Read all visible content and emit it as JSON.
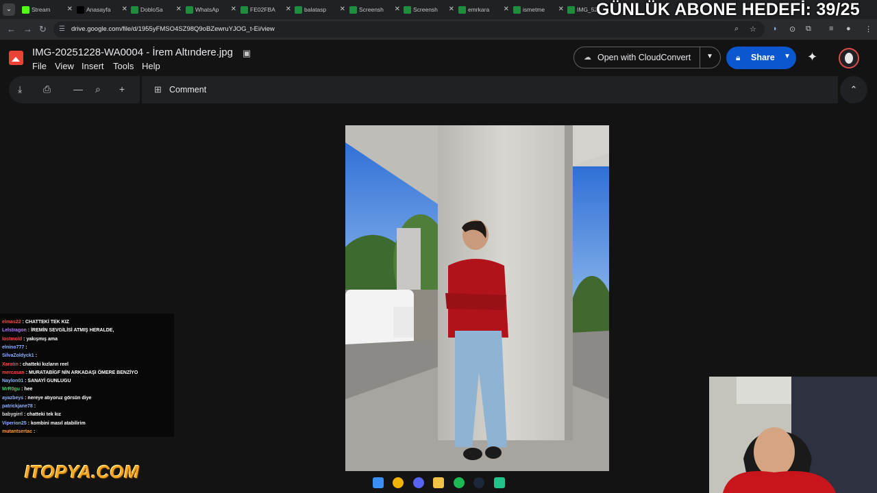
{
  "browser": {
    "tabs": [
      {
        "label": "Stream",
        "icon_color": "#53fc18"
      },
      {
        "label": "Anasayfa",
        "icon_color": "#000000"
      },
      {
        "label": "DobloSa",
        "icon_color": "#1e8e3e"
      },
      {
        "label": "WhatsAp",
        "icon_color": "#1e8e3e"
      },
      {
        "label": "FE02FBA",
        "icon_color": "#1e8e3e"
      },
      {
        "label": "balatasp",
        "icon_color": "#1e8e3e"
      },
      {
        "label": "Screensh",
        "icon_color": "#1e8e3e"
      },
      {
        "label": "Screensh",
        "icon_color": "#1e8e3e"
      },
      {
        "label": "emrkara",
        "icon_color": "#1e8e3e"
      },
      {
        "label": "ismetme",
        "icon_color": "#1e8e3e"
      },
      {
        "label": "IMG_52",
        "icon_color": "#1e8e3e"
      }
    ],
    "url": "drive.google.com/file/d/1955yFMSO4SZ98Q9oBZewruYJOG_t-Ei/view"
  },
  "overlay": {
    "goal_text": "GÜNLÜK ABONE HEDEFİ: 39/25",
    "logo_text": "ITOPYA.COM"
  },
  "drive": {
    "file_name": "IMG-20251228-WA0004 - İrem Altındere.jpg",
    "menus": [
      "File",
      "View",
      "Insert",
      "Tools",
      "Help"
    ],
    "open_with_label": "Open with CloudConvert",
    "share_label": "Share",
    "comment_label": "Comment",
    "accent": "#0b57d0"
  },
  "chat": [
    {
      "user": "elmas22",
      "msg": "CHATTEKİ TEK KIZ",
      "color": "#ff4a4a"
    },
    {
      "user": "Lelstragon",
      "msg": "İREMİN SEVGİLİSİ ATMIŞ HERALDE,",
      "color": "#b57cff"
    },
    {
      "user": "lostmold",
      "msg": "yakışmış ama",
      "color": "#ff4a4a"
    },
    {
      "user": "elnino777",
      "msg": "",
      "color": "#8fb3ff"
    },
    {
      "user": "SilvaZoldyck1",
      "msg": "",
      "color": "#8fb3ff"
    },
    {
      "user": "Xaratın",
      "msg": "chatteki kızların reel",
      "color": "#ff4a4a"
    },
    {
      "user": "mercasan",
      "msg": "MURATABİGF NİN ARKADAŞI ÖMERE BENZİYO",
      "color": "#ff4a4a"
    },
    {
      "user": "Naylon01",
      "msg": "SANAYİ GUNLUGU",
      "color": "#8fb3ff"
    },
    {
      "user": "MrR0gu",
      "msg": "hee",
      "color": "#3fd36a"
    },
    {
      "user": "ayazbeys",
      "msg": "nereye atıyoruz görsün diye",
      "color": "#8fb3ff"
    },
    {
      "user": "patrickjane78",
      "msg": "",
      "color": "#8fb3ff"
    },
    {
      "user": "babygirrl",
      "msg": "chatteki tek kız",
      "color": "#dddddd"
    },
    {
      "user": "Viperion25",
      "msg": "kombini masıl atabilirim",
      "color": "#8fb3ff"
    },
    {
      "user": "mutantsertac",
      "msg": "",
      "color": "#ff9e3d"
    }
  ]
}
